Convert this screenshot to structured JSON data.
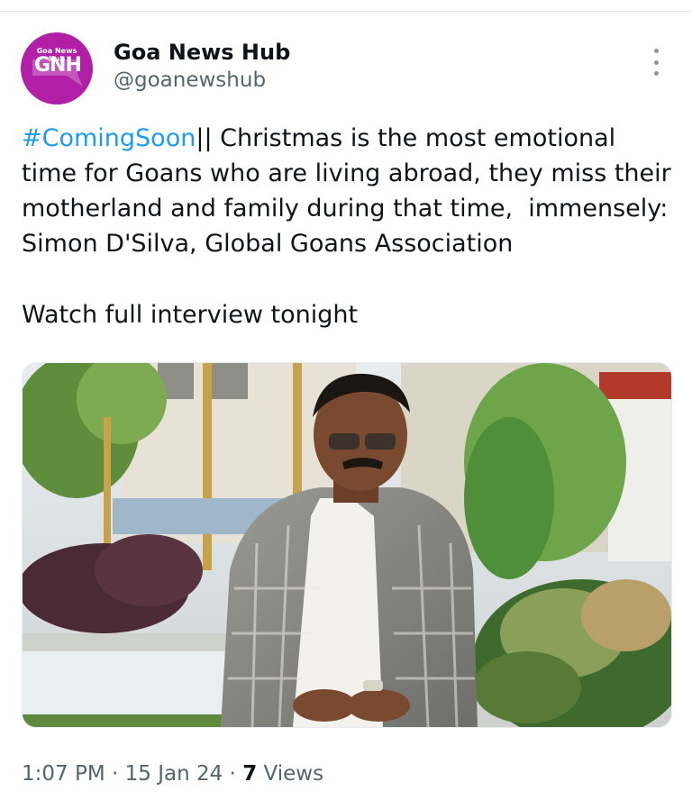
{
  "account": {
    "name": "Goa News Hub",
    "handle": "@goanewshub",
    "avatar_small_text": "Goa News Hub",
    "avatar_big_text": "GNH"
  },
  "tweet": {
    "hashtag": "#ComingSoon",
    "line1_rest": "|| Christmas is the most emotional",
    "line2": "time for Goans who are living abroad, they miss their",
    "line3": "motherland and family during that time,  immensely:",
    "line4": "Simon D'Silva, Global Goans Association",
    "line5": "Watch full interview tonight"
  },
  "meta": {
    "time": "1:07 PM",
    "separator1": " · ",
    "date": "15 Jan 24",
    "separator2": " · ",
    "views_count": "7",
    "views_label": " Views"
  },
  "colors": {
    "link": "#1d9bf0",
    "avatar_bg": "#b01fa5",
    "secondary_text": "#536471"
  },
  "icons": {
    "more": "more-vertical-icon"
  }
}
